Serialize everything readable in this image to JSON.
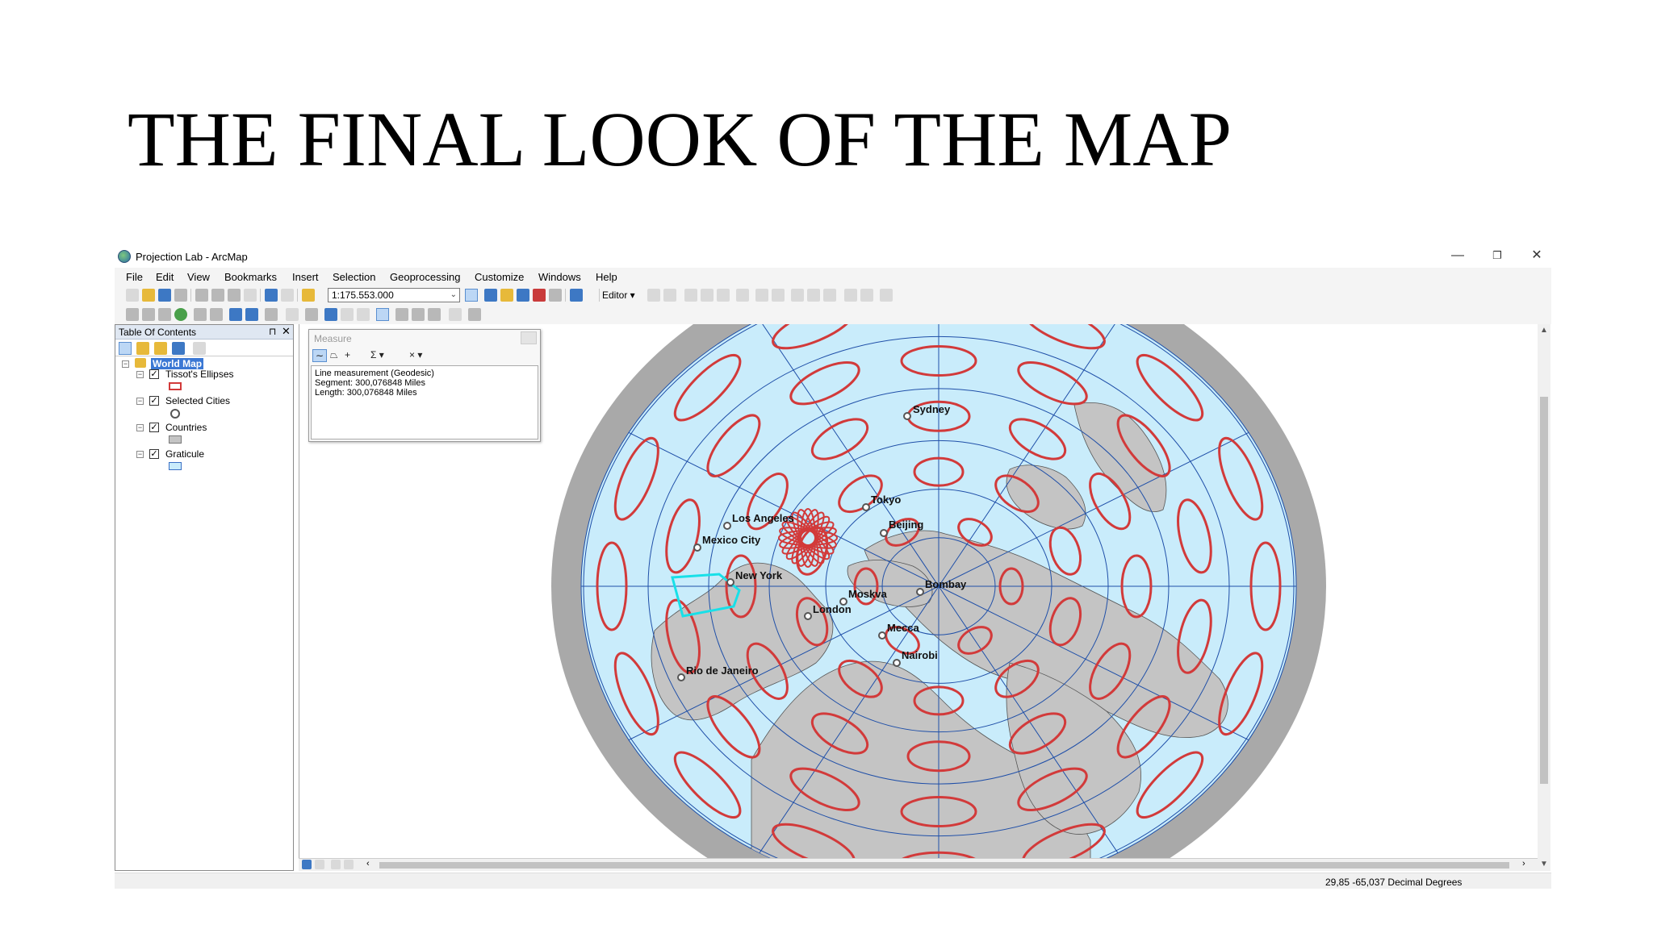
{
  "slide": {
    "title": "THE FINAL LOOK OF THE MAP"
  },
  "window": {
    "title": "Projection Lab - ArcMap",
    "minimize": "—",
    "restore": "❐",
    "close": "✕"
  },
  "menu": [
    "File",
    "Edit",
    "View",
    "Bookmarks",
    "Insert",
    "Selection",
    "Geoprocessing",
    "Customize",
    "Windows",
    "Help"
  ],
  "toolbar": {
    "scale": "1:175.553.000",
    "editor_label": "Editor ▾"
  },
  "toc": {
    "title": "Table Of Contents",
    "pin": "⊓",
    "close": "✕",
    "root": "World Map",
    "layers": [
      {
        "name": "Tissot's Ellipses",
        "checked": true,
        "symbol": "red-rectangle"
      },
      {
        "name": "Selected Cities",
        "checked": true,
        "symbol": "grey-circle"
      },
      {
        "name": "Countries",
        "checked": true,
        "symbol": "grey-rectangle"
      },
      {
        "name": "Graticule",
        "checked": true,
        "symbol": "blue-rectangle"
      }
    ]
  },
  "measure": {
    "title": "Measure",
    "lines": [
      "Line measurement (Geodesic)",
      "Segment: 300,076848 Miles",
      "Length: 300,076848 Miles"
    ]
  },
  "map": {
    "ocean_color": "#c9ecfb",
    "land_color": "#c4c4c4",
    "outer_ring_color": "#a9a9a9",
    "ellipse_color": "#d23a3a",
    "graticule_color": "#1f4fa8",
    "measure_line_color": "#18e0e8",
    "cities": [
      {
        "name": "Sydney"
      },
      {
        "name": "Tokyo"
      },
      {
        "name": "Beijing"
      },
      {
        "name": "Los Angeles"
      },
      {
        "name": "Mexico City"
      },
      {
        "name": "New York"
      },
      {
        "name": "Bombay"
      },
      {
        "name": "Moskva"
      },
      {
        "name": "London"
      },
      {
        "name": "Mecca"
      },
      {
        "name": "Nairobi"
      },
      {
        "name": "Rio de Janeiro"
      }
    ]
  },
  "status": {
    "coords": "29,85  -65,037 Decimal Degrees"
  }
}
